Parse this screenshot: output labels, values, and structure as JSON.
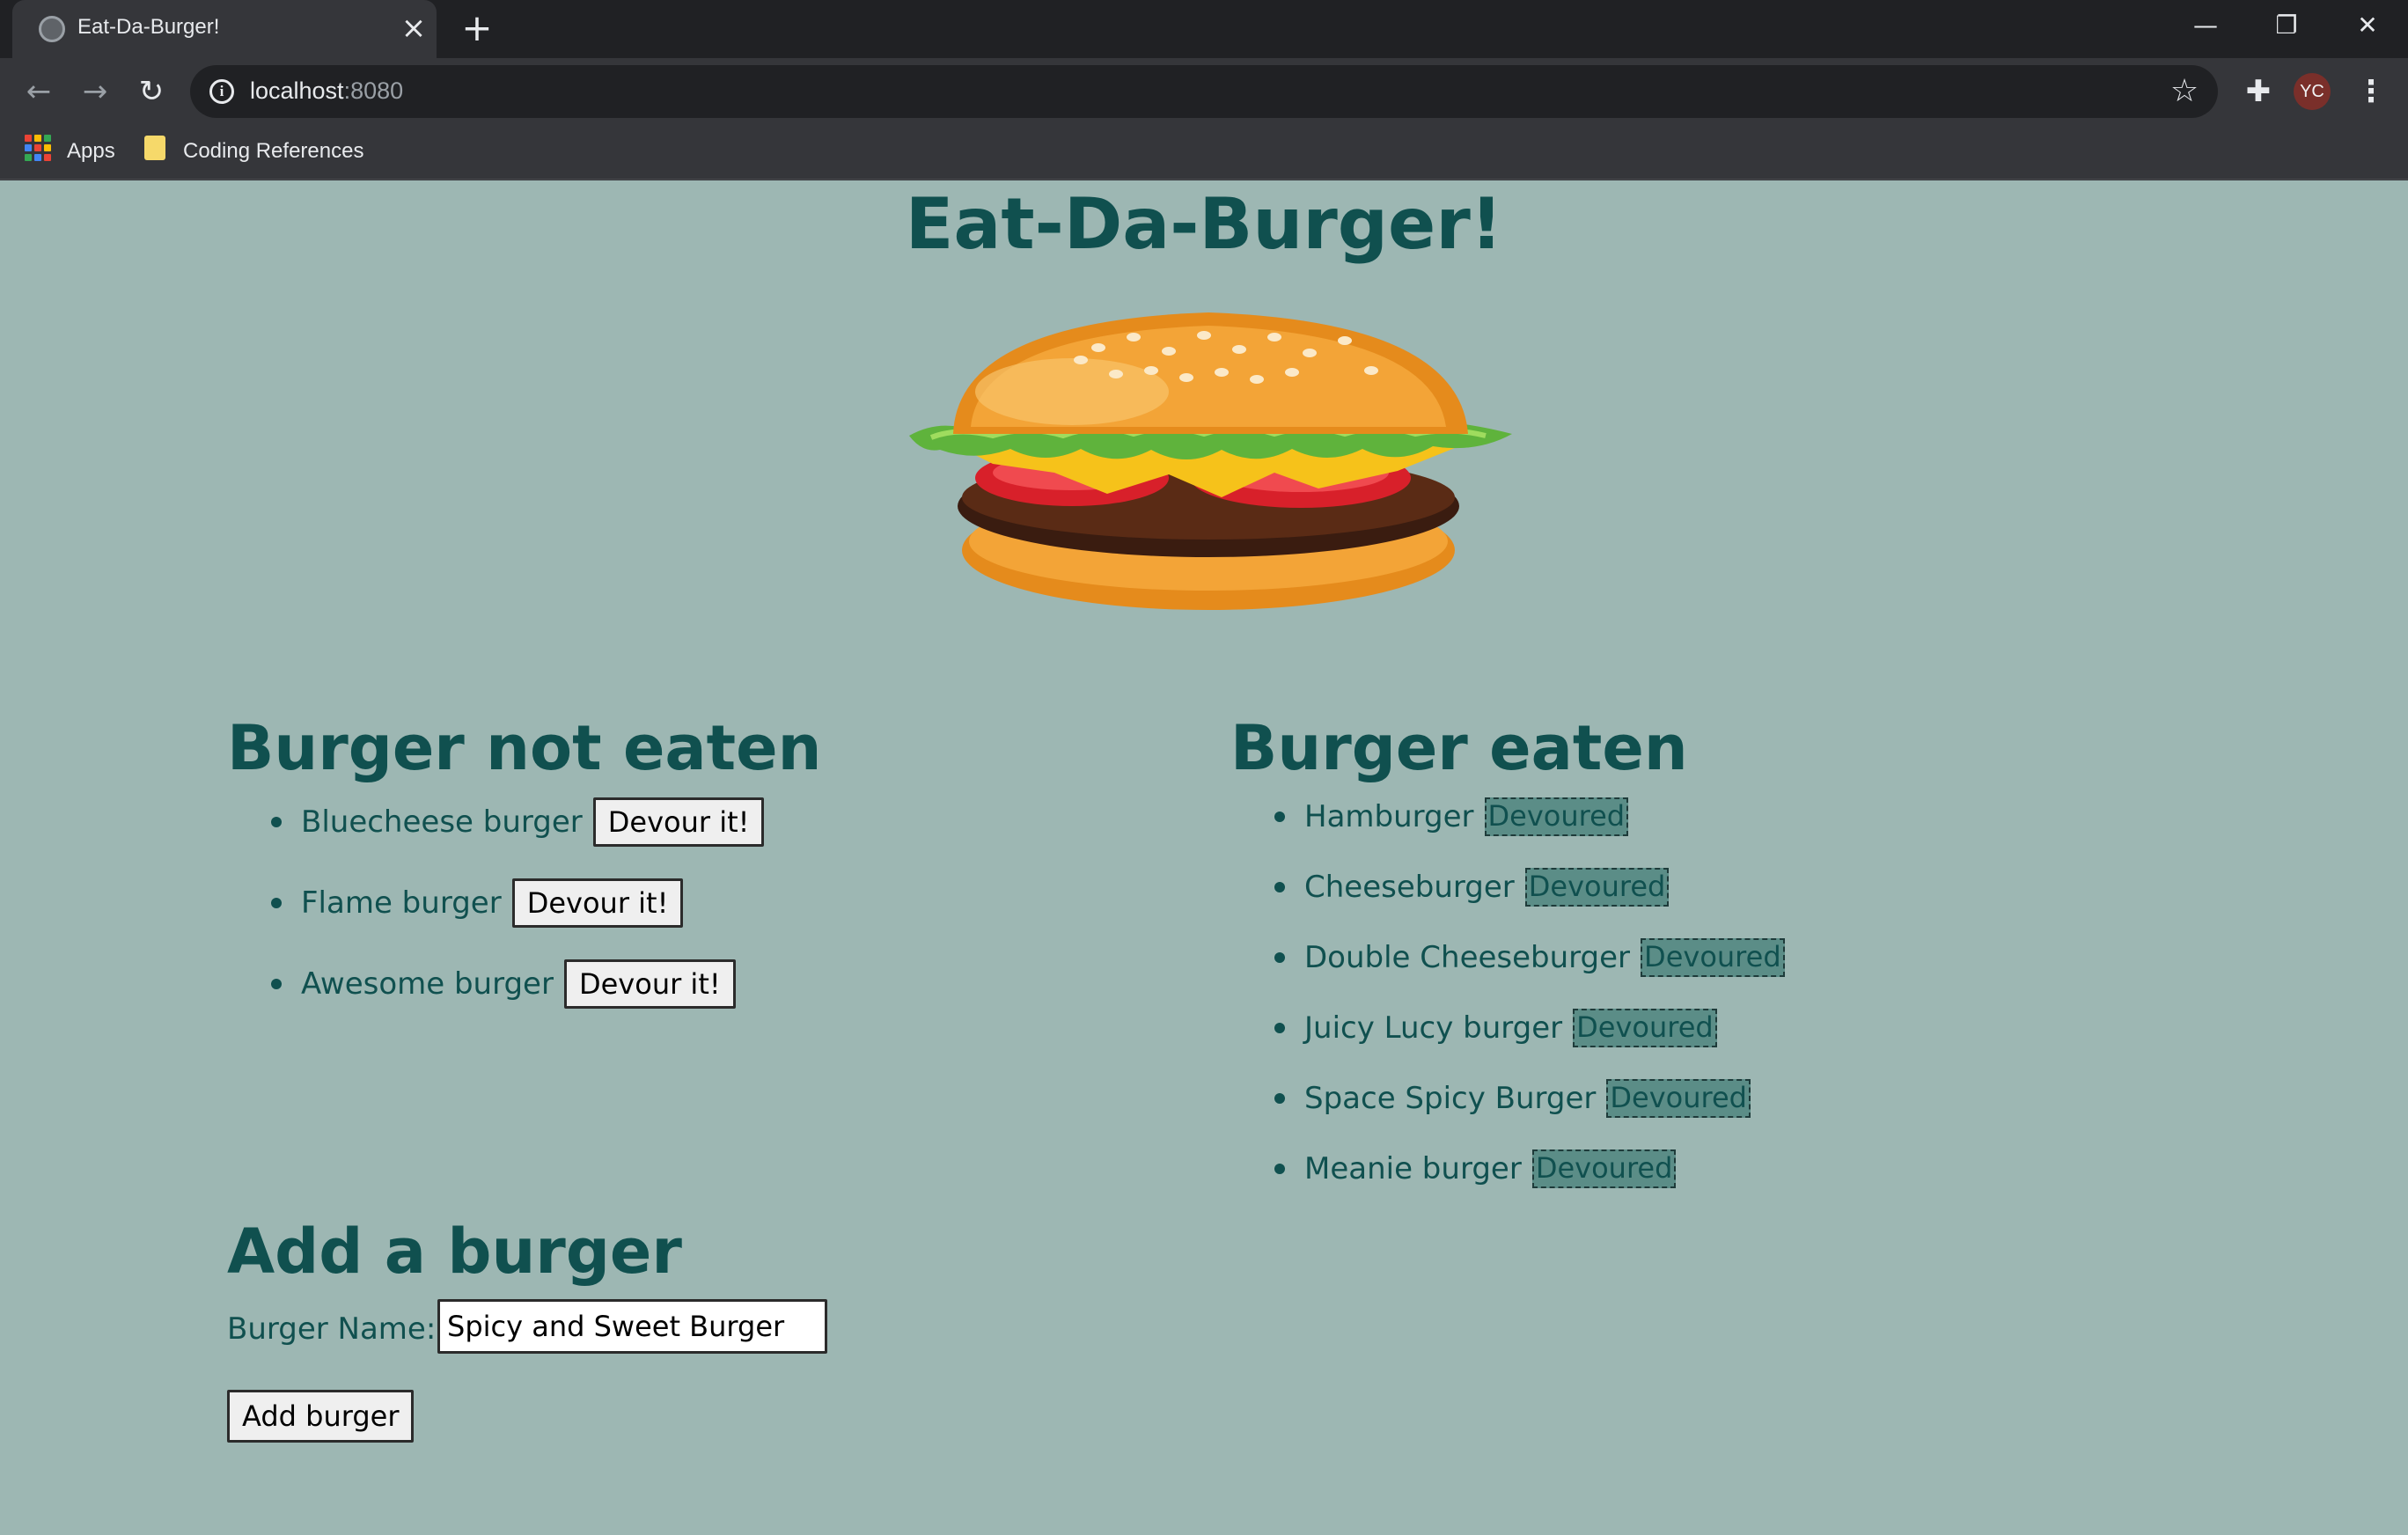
{
  "browser": {
    "tab_title": "Eat-Da-Burger!",
    "url_host": "localhost",
    "url_port": ":8080",
    "profile_initials": "YC",
    "bookmarks": [
      {
        "label": "Apps",
        "icon": "apps-grid-icon"
      },
      {
        "label": "Coding References",
        "icon": "folder-icon"
      }
    ]
  },
  "page": {
    "title": "Eat-Da-Burger!",
    "hero_image": "burger-illustration"
  },
  "uneaten": {
    "heading": "Burger not eaten",
    "button_label": "Devour it!",
    "items": [
      {
        "name": "Bluecheese burger"
      },
      {
        "name": "Flame burger"
      },
      {
        "name": "Awesome burger"
      }
    ]
  },
  "eaten": {
    "heading": "Burger eaten",
    "badge_label": "Devoured",
    "items": [
      {
        "name": "Hamburger"
      },
      {
        "name": "Cheeseburger"
      },
      {
        "name": "Double Cheeseburger"
      },
      {
        "name": "Juicy Lucy burger"
      },
      {
        "name": "Space Spicy Burger"
      },
      {
        "name": "Meanie burger"
      }
    ]
  },
  "add_form": {
    "heading": "Add a burger",
    "label": "Burger Name:",
    "input_value": "Spicy and Sweet Burger",
    "submit_label": "Add burger"
  },
  "colors": {
    "page_background": "#9db7b3",
    "text_teal": "#10504f",
    "devoured_badge": "#5b8d87",
    "chrome_dark": "#202124",
    "chrome_toolbar": "#35363a"
  }
}
